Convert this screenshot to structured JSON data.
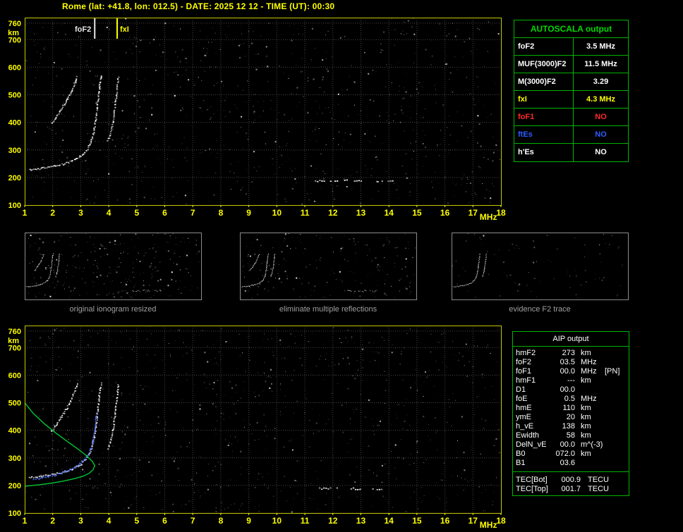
{
  "title": "Rome (lat: +41.8, lon: 012.5) - DATE: 2025 12 12 - TIME (UT): 00:30",
  "colors": {
    "background": "#000000",
    "axis": "#ffff00",
    "plot_border": "#c8c800",
    "grid": "#474747",
    "noise": "#ffffff",
    "table_border": "#00b400",
    "autoscala_header_green": "#00d800",
    "profile_green": "#00c832",
    "trace_blue": "#5577ff",
    "caption_gray": "#a0a0a0",
    "fof2_marker": "#e8e8e8",
    "fxi_marker": "#ffff00",
    "no_red": "#ff2a2a",
    "no_blue": "#2f5bff"
  },
  "captions": [
    "original ionogram resized",
    "eliminate multiple reflections",
    "evidence F2 trace"
  ],
  "autoscala": {
    "header": "AUTOSCALA output",
    "rows": [
      {
        "label": "foF2",
        "value": "3.5 MHz",
        "color": "#ffffff"
      },
      {
        "label": "MUF(3000)F2",
        "value": "11.5 MHz",
        "color": "#ffffff"
      },
      {
        "label": "M(3000)F2",
        "value": "3.29",
        "color": "#ffffff"
      },
      {
        "label": "fxI",
        "value": "4.3 MHz",
        "color": "#ffff00"
      },
      {
        "label": "foF1",
        "value": "NO",
        "color": "#ff2a2a"
      },
      {
        "label": "ftEs",
        "value": "NO",
        "color": "#2f5bff"
      },
      {
        "label": "h'Es",
        "value": "NO",
        "color": "#ffffff"
      }
    ]
  },
  "aip": {
    "header": "AIP output",
    "rows": [
      {
        "label": "hmF2",
        "value": "273",
        "unit": "km",
        "extra": ""
      },
      {
        "label": "foF2",
        "value": "03.5",
        "unit": "MHz",
        "extra": ""
      },
      {
        "label": "foF1",
        "value": "00.0",
        "unit": "MHz",
        "extra": "[PN]"
      },
      {
        "label": "hmF1",
        "value": "---",
        "unit": "km",
        "extra": ""
      },
      {
        "label": "D1",
        "value": "00.0",
        "unit": "",
        "extra": ""
      },
      {
        "label": "foE",
        "value": "0.5",
        "unit": "MHz",
        "extra": ""
      },
      {
        "label": "hmE",
        "value": "110",
        "unit": "km",
        "extra": ""
      },
      {
        "label": "ymE",
        "value": "20",
        "unit": "km",
        "extra": ""
      },
      {
        "label": "h_vE",
        "value": "138",
        "unit": "km",
        "extra": ""
      },
      {
        "label": "Ewidth",
        "value": "58",
        "unit": "km",
        "extra": ""
      },
      {
        "label": "DelN_vE",
        "value": "00.0",
        "unit": "m^(-3)",
        "extra": ""
      },
      {
        "label": "B0",
        "value": "072.0",
        "unit": "km",
        "extra": ""
      },
      {
        "label": "B1",
        "value": "03.6",
        "unit": "",
        "extra": ""
      }
    ],
    "tec_rows": [
      {
        "label": "TEC[Bot]",
        "value": "000.9",
        "unit": "TECU"
      },
      {
        "label": "TEC[Top]",
        "value": "001.7",
        "unit": "TECU"
      }
    ]
  },
  "chart_data": [
    {
      "id": "main_ionogram",
      "type": "scatter",
      "title": "vertical incidence ionogram",
      "xlabel": "MHz",
      "ylabel": "km",
      "xlim": [
        1,
        18
      ],
      "ylim": [
        100,
        780
      ],
      "x_ticks": [
        1,
        2,
        3,
        4,
        5,
        6,
        7,
        8,
        9,
        10,
        11,
        12,
        13,
        14,
        15,
        16,
        17,
        18
      ],
      "y_ticks": [
        100,
        200,
        300,
        400,
        500,
        600,
        700,
        760
      ],
      "grid": true,
      "legend_position": "none",
      "markers": [
        {
          "name": "foF2",
          "label": "foF2",
          "x": 3.5,
          "color": "#e8e8e8"
        },
        {
          "name": "fxI",
          "label": "fxI",
          "x": 4.3,
          "color": "#ffff00"
        }
      ],
      "traces": [
        {
          "name": "F2-ordinary-trace",
          "points": [
            [
              1.15,
              230
            ],
            [
              1.5,
              234
            ],
            [
              1.9,
              240
            ],
            [
              2.3,
              249
            ],
            [
              2.7,
              262
            ],
            [
              3.0,
              280
            ],
            [
              3.2,
              301
            ],
            [
              3.35,
              331
            ],
            [
              3.45,
              372
            ],
            [
              3.55,
              438
            ],
            [
              3.62,
              505
            ],
            [
              3.68,
              556
            ],
            [
              3.72,
              576
            ]
          ]
        },
        {
          "name": "F2-extraordinary-trace",
          "points": [
            [
              3.95,
              336
            ],
            [
              4.05,
              366
            ],
            [
              4.15,
              415
            ],
            [
              4.23,
              480
            ],
            [
              4.29,
              540
            ],
            [
              4.33,
              574
            ]
          ]
        },
        {
          "name": "second-hop-multiple-reflection",
          "points": [
            [
              1.95,
              398
            ],
            [
              2.1,
              420
            ],
            [
              2.3,
              452
            ],
            [
              2.5,
              484
            ],
            [
              2.65,
              516
            ],
            [
              2.78,
              548
            ],
            [
              2.87,
              572
            ]
          ]
        }
      ],
      "echo_band_km": 190,
      "echo_segments_mhz": [
        [
          11.35,
          12.15
        ],
        [
          12.4,
          12.6
        ],
        [
          12.75,
          13.1
        ],
        [
          13.5,
          13.8
        ],
        [
          13.95,
          14.15
        ]
      ]
    },
    {
      "id": "interpreted_ionogram",
      "type": "scatter",
      "title": "ionogram with autoscaled trace and electron density profile",
      "xlabel": "MHz",
      "ylabel": "km",
      "xlim": [
        1,
        18
      ],
      "ylim": [
        100,
        780
      ],
      "x_ticks": [
        1,
        2,
        3,
        4,
        5,
        6,
        7,
        8,
        9,
        10,
        11,
        12,
        13,
        14,
        15,
        16,
        17,
        18
      ],
      "y_ticks": [
        100,
        200,
        300,
        400,
        500,
        600,
        700,
        760
      ],
      "grid": true,
      "traces_same_as": "main_ionogram",
      "echo_band_km": 190,
      "echo_segments_mhz": [
        [
          11.5,
          12.2
        ],
        [
          12.55,
          12.95
        ],
        [
          13.4,
          13.75
        ]
      ],
      "profile": {
        "name": "electron-density-profile",
        "color": "#00c832",
        "points": [
          [
            1.0,
            500
          ],
          [
            1.3,
            462
          ],
          [
            1.7,
            424
          ],
          [
            2.1,
            391
          ],
          [
            2.5,
            361
          ],
          [
            2.9,
            332
          ],
          [
            3.2,
            308
          ],
          [
            3.4,
            289
          ],
          [
            3.5,
            272
          ],
          [
            3.44,
            257
          ],
          [
            3.3,
            244
          ],
          [
            3.1,
            234
          ],
          [
            2.8,
            225
          ],
          [
            2.4,
            216
          ],
          [
            2.0,
            209
          ],
          [
            1.5,
            202
          ],
          [
            1.0,
            197
          ]
        ]
      },
      "scaled_trace": {
        "name": "autoscaled-F2-trace",
        "color": "#5577ff",
        "points": [
          [
            1.3,
            224
          ],
          [
            1.6,
            229
          ],
          [
            1.95,
            236
          ],
          [
            2.3,
            247
          ],
          [
            2.6,
            259
          ],
          [
            2.9,
            276
          ],
          [
            3.1,
            295
          ],
          [
            3.3,
            322
          ],
          [
            3.42,
            362
          ],
          [
            3.5,
            420
          ],
          [
            3.55,
            468
          ]
        ]
      }
    },
    {
      "id": "processing_thumbnails",
      "type": "scatter",
      "captions": [
        "original ionogram resized",
        "eliminate multiple reflections",
        "evidence F2 trace"
      ],
      "xlim": [
        1,
        18
      ],
      "ylim": [
        100,
        780
      ],
      "traces_same_as": "main_ionogram"
    }
  ]
}
